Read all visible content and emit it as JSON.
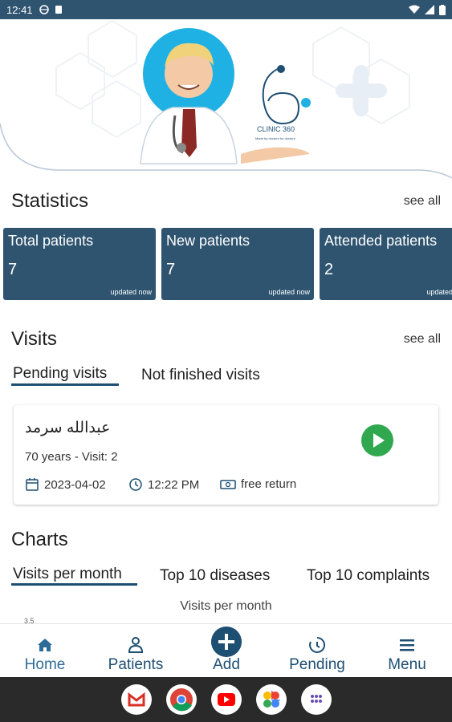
{
  "status_bar": {
    "time": "12:41"
  },
  "hero": {
    "logo_text": "CLINIC 360",
    "logo_tagline": "Made by doctors for doctors"
  },
  "statistics": {
    "title": "Statistics",
    "see_all": "see all",
    "cards": [
      {
        "label": "Total patients",
        "value": "7",
        "updated": "updated now"
      },
      {
        "label": "New patients",
        "value": "7",
        "updated": "updated now"
      },
      {
        "label": "Attended patients",
        "value": "2",
        "updated": "updated now"
      }
    ]
  },
  "visits": {
    "title": "Visits",
    "see_all": "see all",
    "tabs": [
      {
        "label": "Pending visits"
      },
      {
        "label": "Not finished visits"
      }
    ],
    "card": {
      "patient_name": "عبدالله سرمد",
      "details": "70 years - Visit: 2",
      "date": "2023-04-02",
      "time": "12:22 PM",
      "type": "free return"
    }
  },
  "charts": {
    "title": "Charts",
    "tabs": [
      {
        "label": "Visits per month"
      },
      {
        "label": "Top 10 diseases"
      },
      {
        "label": "Top 10 complaints"
      }
    ],
    "chart_title": "Visits per month",
    "first_tick": "3.5"
  },
  "bottom_nav": [
    {
      "label": "Home",
      "icon": "home-icon"
    },
    {
      "label": "Patients",
      "icon": "patients-icon"
    },
    {
      "label": "Add",
      "icon": "add-icon"
    },
    {
      "label": "Pending",
      "icon": "pending-icon"
    },
    {
      "label": "Menu",
      "icon": "menu-icon"
    }
  ],
  "colors": {
    "primary": "#2f5470",
    "accent": "#1d4f73",
    "play": "#2fa84f",
    "status_bar": "#2f5470"
  }
}
